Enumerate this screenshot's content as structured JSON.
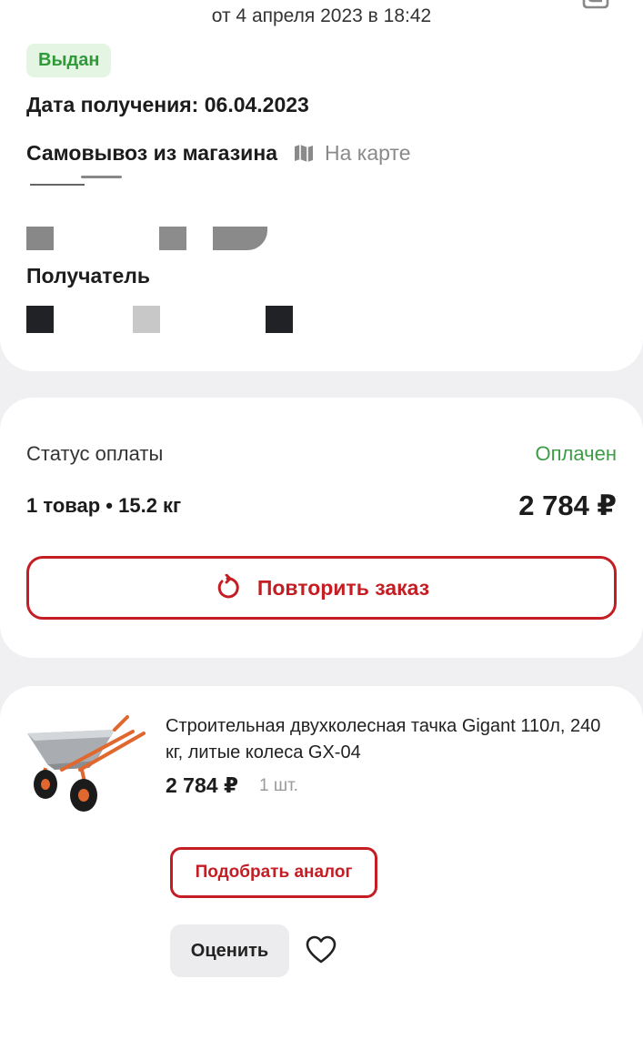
{
  "header": {
    "order_date": "от 4 апреля 2023 в 18:42",
    "back_icon": "chevron-left-icon",
    "copy_icon": "copy-icon"
  },
  "order": {
    "status": "Выдан",
    "receive_date": "Дата получения: 06.04.2023",
    "pickup_label": "Самовывоз из магазина",
    "map_icon": "map-icon",
    "map_link": "На карте",
    "recipient_label": "Получатель"
  },
  "payment": {
    "status_label": "Статус оплаты",
    "status_value": "Оплачен",
    "summary": "1 товар • 15.2 кг",
    "total": "2 784 ₽",
    "repeat_button": "Повторить заказ",
    "repeat_icon": "refresh-icon"
  },
  "product": {
    "title": "Строительная двухколесная тачка Gigant 110л, 240 кг, литые колеса GX-04",
    "price": "2 784 ₽",
    "quantity": "1 шт.",
    "analog_button": "Подобрать аналог",
    "rate_button": "Оценить",
    "favorite_icon": "heart-icon"
  },
  "colors": {
    "accent": "#c41e24",
    "success": "#3d9c46",
    "badge_bg": "#e4f5e4",
    "page_bg": "#f0f0f2"
  }
}
